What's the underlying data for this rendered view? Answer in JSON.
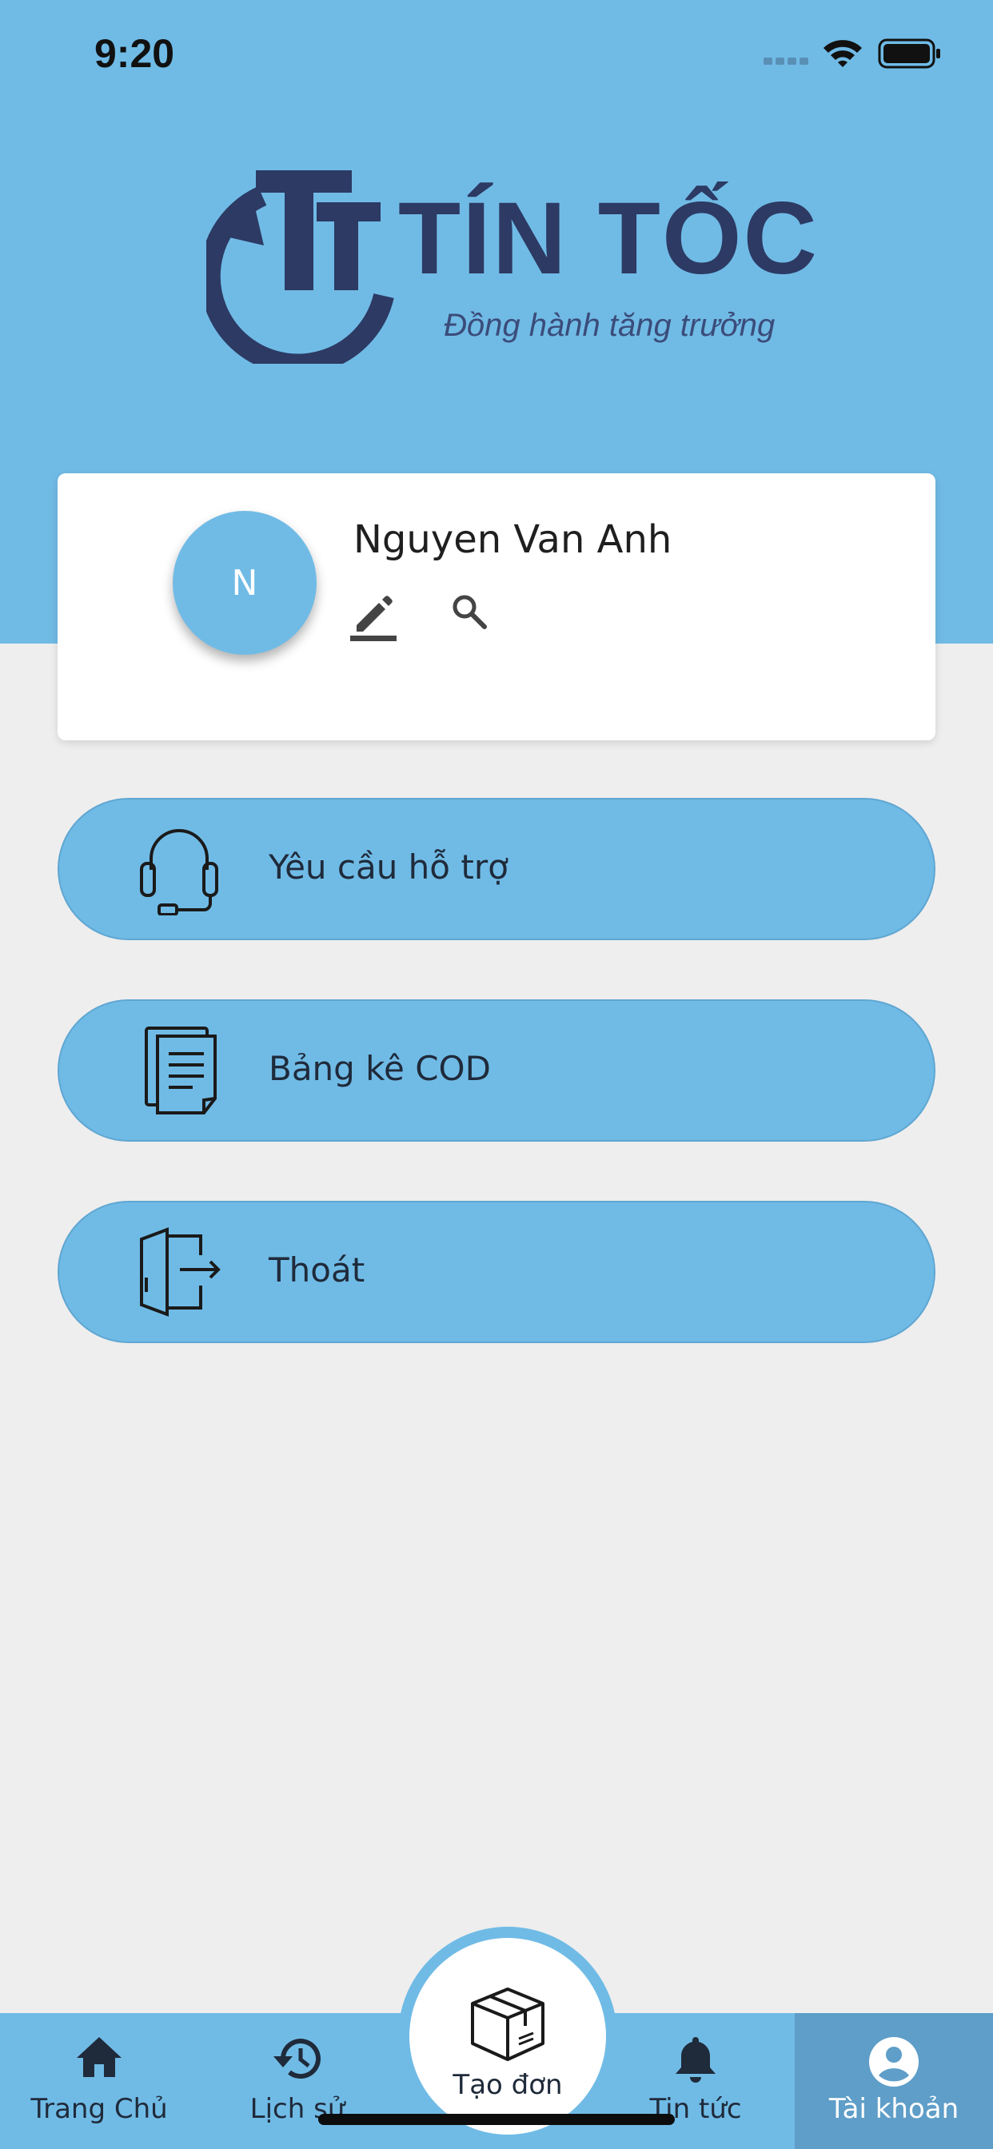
{
  "status_bar": {
    "time": "9:20"
  },
  "brand": {
    "name": "TÍN TỐC",
    "slogan": "Đồng hành tăng trưởng",
    "color": "#2c3a64"
  },
  "profile": {
    "avatar_initial": "N",
    "name": "Nguyen Van Anh",
    "edit_icon": "pencil-icon",
    "search_icon": "search-icon"
  },
  "menu": {
    "items": [
      {
        "label": "Yêu cầu hỗ trợ",
        "icon": "headset-icon"
      },
      {
        "label": "Bảng kê COD",
        "icon": "document-icon"
      },
      {
        "label": "Thoát",
        "icon": "logout-icon"
      }
    ]
  },
  "bottom_nav": {
    "items": [
      {
        "label": "Trang Chủ",
        "icon": "home-icon"
      },
      {
        "label": "Lịch sử",
        "icon": "history-icon"
      },
      {
        "label": "Tạo đơn",
        "icon": "package-icon"
      },
      {
        "label": "Tin tức",
        "icon": "bell-icon"
      },
      {
        "label": "Tài khoản",
        "icon": "account-icon",
        "active": true
      }
    ]
  },
  "colors": {
    "primary": "#70bbe6",
    "active_tab": "#5e9ec8",
    "background": "#eeeeee"
  }
}
